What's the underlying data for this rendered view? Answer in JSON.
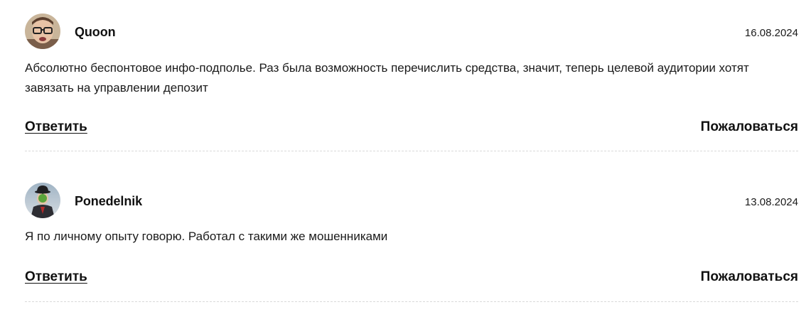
{
  "comments": [
    {
      "author": "Quoon",
      "date": "16.08.2024",
      "text": "Абсолютно беспонтовое инфо-подполье. Раз была возможность перечислить средства, значит, теперь целевой аудитории хотят завязать на управлении депозит",
      "reply_label": "Ответить",
      "report_label": "Пожаловаться",
      "avatar": "avatar-man-with-glasses"
    },
    {
      "author": "Ponedelnik",
      "date": "13.08.2024",
      "text": "Я по личному опыту говорю. Работал с такими же мошенниками",
      "reply_label": "Ответить",
      "report_label": "Пожаловаться",
      "avatar": "avatar-man-with-bowler-hat-and-apple"
    }
  ],
  "colors": {
    "text": "#1a1a1a",
    "divider": "#d9d9d9"
  }
}
